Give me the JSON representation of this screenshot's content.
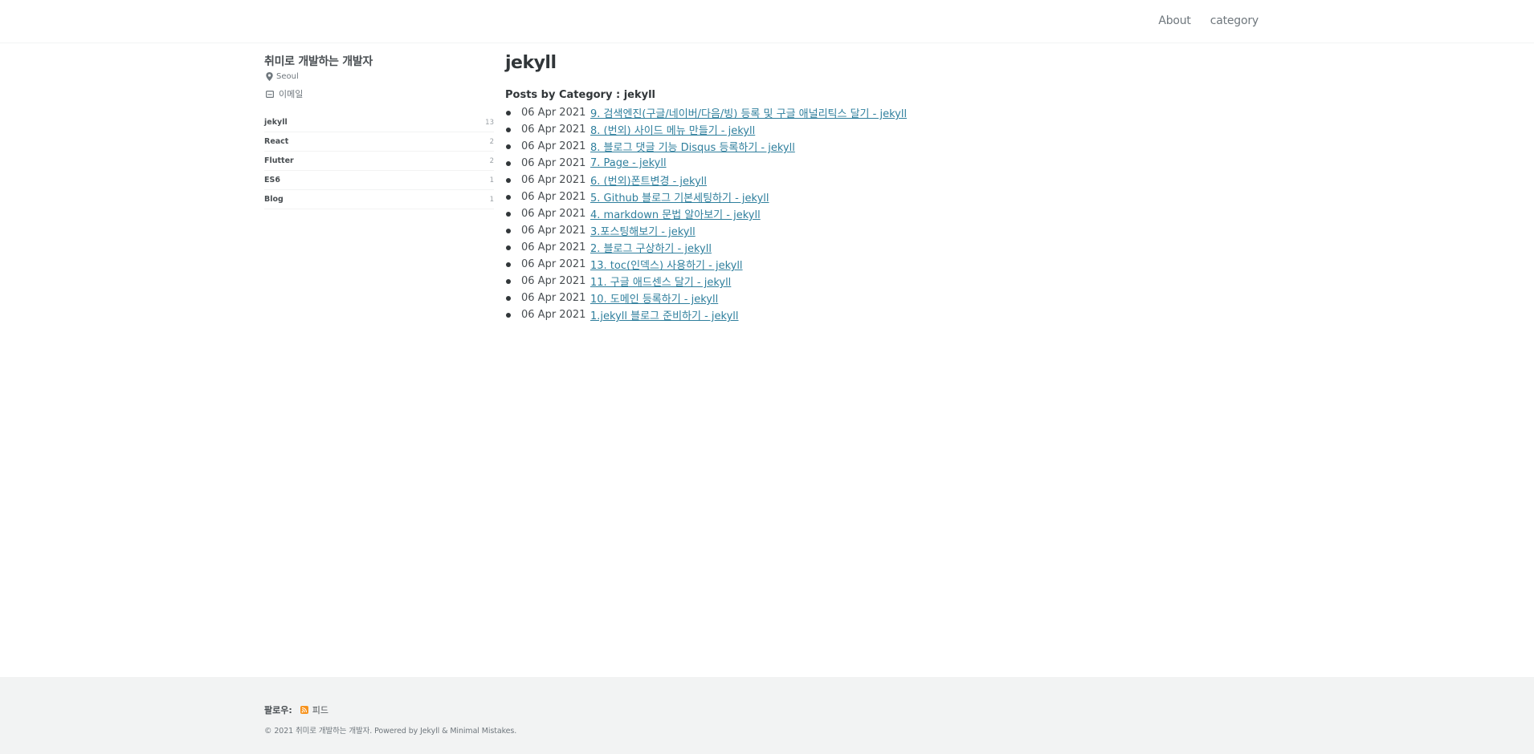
{
  "nav": {
    "items": [
      "About",
      "category"
    ]
  },
  "author": {
    "name": "취미로 개발하는 개발자",
    "location": "Seoul",
    "email_label": "이메일"
  },
  "categories": [
    {
      "name": "jekyll",
      "count": "13"
    },
    {
      "name": "React",
      "count": "2"
    },
    {
      "name": "Flutter",
      "count": "2"
    },
    {
      "name": "ES6",
      "count": "1"
    },
    {
      "name": "Blog",
      "count": "1"
    }
  ],
  "main": {
    "title": "jekyll",
    "section_title": "Posts by Category : jekyll",
    "posts": [
      {
        "date": "06 Apr 2021",
        "title": "9. 검색엔진(구글/네이버/다음/빙) 등록 및 구글 애널리틱스 달기 - jekyll"
      },
      {
        "date": "06 Apr 2021",
        "title": "8. (번외) 사이드 메뉴 만들기 - jekyll"
      },
      {
        "date": "06 Apr 2021",
        "title": "8. 블로그 댓글 기능 Disqus 등록하기 - jekyll"
      },
      {
        "date": "06 Apr 2021",
        "title": "7. Page - jekyll"
      },
      {
        "date": "06 Apr 2021",
        "title": "6. (번외)폰트변경 - jekyll"
      },
      {
        "date": "06 Apr 2021",
        "title": "5. Github 블로그 기본세팅하기 - jekyll"
      },
      {
        "date": "06 Apr 2021",
        "title": "4. markdown 문법 알아보기 - jekyll"
      },
      {
        "date": "06 Apr 2021",
        "title": "3.포스팅해보기 - jekyll"
      },
      {
        "date": "06 Apr 2021",
        "title": "2. 블로그 구상하기 - jekyll"
      },
      {
        "date": "06 Apr 2021",
        "title": "13. toc(인덱스) 사용하기 - jekyll"
      },
      {
        "date": "06 Apr 2021",
        "title": "11. 구글 애드센스 달기 - jekyll"
      },
      {
        "date": "06 Apr 2021",
        "title": "10. 도메인 등록하기 - jekyll"
      },
      {
        "date": "06 Apr 2021",
        "title": "1.jekyll 블로그 준비하기 - jekyll"
      }
    ]
  },
  "footer": {
    "follow_label": "팔로우:",
    "feed_label": "피드",
    "copyright": "© 2021 취미로 개발하는 개발자. Powered by Jekyll & Minimal Mistakes."
  },
  "colors": {
    "link": "#2f7f9d",
    "footer_bg": "#f2f3f3",
    "rss": "#f7931e"
  },
  "icons": {
    "location": "map-marker-icon",
    "email": "envelope-icon",
    "feed": "rss-icon"
  }
}
